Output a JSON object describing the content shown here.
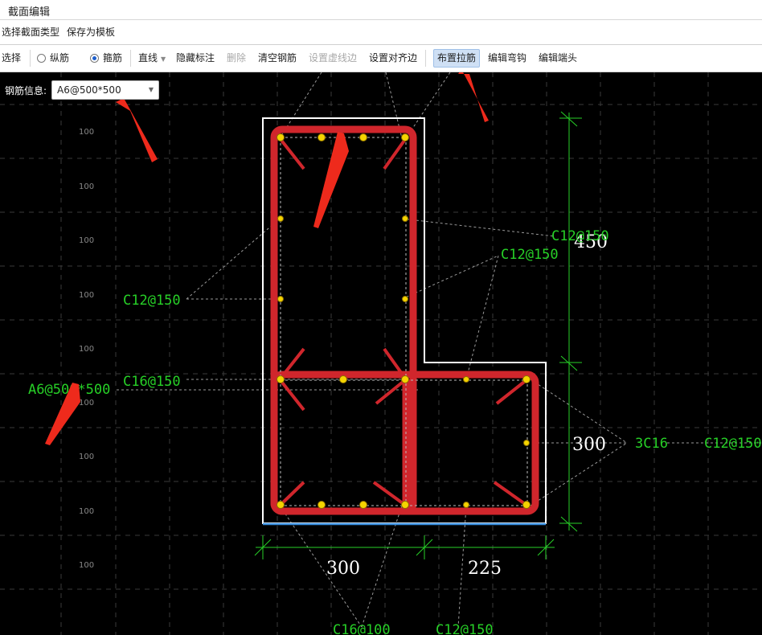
{
  "window": {
    "title": "截面编辑"
  },
  "menu": {
    "items": [
      "选择截面类型",
      "保存为模板"
    ]
  },
  "toolbar": {
    "select": "选择",
    "longitudinal": "纵筋",
    "stirrup": "箍筋",
    "line_mode": "直线",
    "hide_labels": "隐藏标注",
    "delete": "删除",
    "clear_rebar": "清空钢筋",
    "set_dashed_edge": "设置虚线边",
    "set_align_edge": "设置对齐边",
    "place_tie": "布置拉筋",
    "edit_hook": "编辑弯钩",
    "edit_end": "编辑端头"
  },
  "rebar_info": {
    "label": "钢筋信息:",
    "value": "A6@500*500"
  },
  "grid_label": "100",
  "annotations": {
    "stirrup_top_right": "C12@150",
    "stirrup_right_mid": "C12@150",
    "stirrup_left": "C12@150",
    "stirrup_mid": "C16@150",
    "tie_spec": "A6@500*500",
    "corner_bars": "3C16",
    "right_stirrup": "C12@150",
    "bottom_left": "C16@100",
    "bottom_right": "C12@150"
  },
  "dimensions": {
    "top_height": "450",
    "bottom_height": "300",
    "left_width": "300",
    "right_width": "225"
  },
  "colors": {
    "background": "#000000",
    "rebar": "#d0262c",
    "dimension": "#27d027",
    "outline": "#ffffff",
    "bar_dot": "#f5d400"
  }
}
